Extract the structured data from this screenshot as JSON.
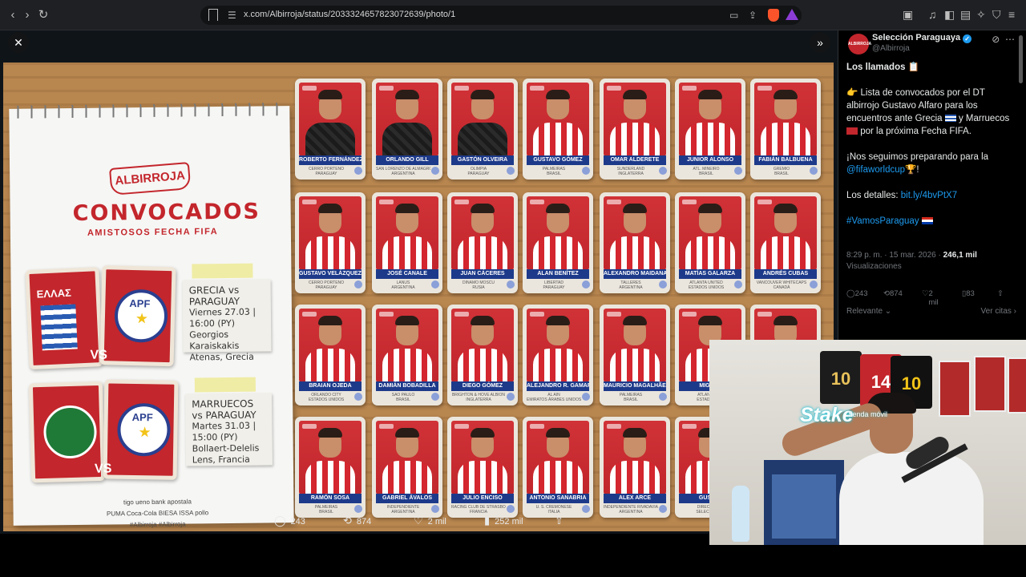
{
  "browser": {
    "url": "x.com/Albirroja/status/2033324657823072639/photo/1",
    "back_glyph": "‹",
    "forward_glyph": "›",
    "reload_glyph": "↻"
  },
  "viewer": {
    "close_glyph": "✕",
    "expand_glyph": "»",
    "stats": {
      "replies": "243",
      "reposts": "874",
      "likes": "2 mil",
      "views": "252 mil"
    }
  },
  "graphic": {
    "brand": "ALBIRROJA",
    "title": "CONVOCADOS",
    "subtitle": "AMISTOSOS FECHA FIFA",
    "greece_label": "ΕΛΛΑΣ",
    "apf_label": "APF",
    "vs": "VS",
    "match1": {
      "line1": "GRECIA vs",
      "line2": "PARAGUAY",
      "line3": "Viernes 27.03 | 16:00 (PY)",
      "line4": "Georgios Karaiskakis",
      "line5": "Atenas, Grecia"
    },
    "match2": {
      "line1": "MARRUECOS",
      "line2": "vs PARAGUAY",
      "line3": "Martes 31.03 | 15:00 (PY)",
      "line4": "Bollaert-Delelis",
      "line5": "Lens, Francia"
    },
    "sponsors_line1": "tigo   ueno bank   apostala",
    "sponsors_line2": "PUMA   Coca-Cola   BIESA   ISSA   pollo",
    "sponsors_line3": "#Albirroja   #Albirroja"
  },
  "players": [
    {
      "name": "ROBERTO FERNÁNDEZ",
      "club": "CERRO PORTEÑO",
      "country": "PARAGUAY",
      "gk": true
    },
    {
      "name": "ORLANDO GILL",
      "club": "SAN LORENZO DE ALMAGRO",
      "country": "ARGENTINA",
      "gk": true
    },
    {
      "name": "GASTÓN OLVEIRA",
      "club": "OLIMPIA",
      "country": "PARAGUAY",
      "gk": true
    },
    {
      "name": "GUSTAVO GÓMEZ",
      "club": "PALMEIRAS",
      "country": "BRASIL",
      "gk": false
    },
    {
      "name": "OMAR ALDERETE",
      "club": "SUNDERLAND",
      "country": "INGLATERRA",
      "gk": false
    },
    {
      "name": "JUNIOR ALONSO",
      "club": "ATL. MINEIRO",
      "country": "BRASIL",
      "gk": false
    },
    {
      "name": "FABIÁN BALBUENA",
      "club": "GRÊMIO",
      "country": "BRASIL",
      "gk": false
    },
    {
      "name": "GUSTAVO VELÁZQUEZ",
      "club": "CERRO PORTEÑO",
      "country": "PARAGUAY",
      "gk": false
    },
    {
      "name": "JOSÉ CANALE",
      "club": "LANÚS",
      "country": "ARGENTINA",
      "gk": false
    },
    {
      "name": "JUAN CÁCERES",
      "club": "DINAMO MOSCÚ",
      "country": "RUSIA",
      "gk": false
    },
    {
      "name": "ALAN BENÍTEZ",
      "club": "LIBERTAD",
      "country": "PARAGUAY",
      "gk": false
    },
    {
      "name": "ALEXANDRO MAIDANA",
      "club": "TALLERES",
      "country": "ARGENTINA",
      "gk": false
    },
    {
      "name": "MATÍAS GALARZA",
      "club": "ATLANTA UNITED",
      "country": "ESTADOS UNIDOS",
      "gk": false
    },
    {
      "name": "ANDRÉS CUBAS",
      "club": "VANCOUVER WHITECAPS",
      "country": "CANADÁ",
      "gk": false
    },
    {
      "name": "BRAIAN OJEDA",
      "club": "ORLANDO CITY",
      "country": "ESTADOS UNIDOS",
      "gk": false
    },
    {
      "name": "DAMIÁN BOBADILLA",
      "club": "SÃO PAULO",
      "country": "BRASIL",
      "gk": false
    },
    {
      "name": "DIEGO GÓMEZ",
      "club": "BRIGHTON & HOVE ALBION",
      "country": "INGLATERRA",
      "gk": false
    },
    {
      "name": "ALEJANDRO R. GAMARRA",
      "club": "AL AIN",
      "country": "EMIRATOS ÁRABES UNIDOS",
      "gk": false
    },
    {
      "name": "MAURICIO MAGALHÃES",
      "club": "PALMEIRAS",
      "country": "BRASIL",
      "gk": false
    },
    {
      "name": "MIGUEL",
      "club": "ATLANTA",
      "country": "ESTADOS",
      "gk": false
    },
    {
      "name": "",
      "club": "",
      "country": "",
      "gk": false
    },
    {
      "name": "RAMÓN SOSA",
      "club": "PALMEIRAS",
      "country": "BRASIL",
      "gk": false
    },
    {
      "name": "GABRIEL ÁVALOS",
      "club": "INDEPENDIENTE",
      "country": "ARGENTINA",
      "gk": false
    },
    {
      "name": "JULIO ENCISO",
      "club": "RACING CLUB DE STRASBOURG",
      "country": "FRANCIA",
      "gk": false
    },
    {
      "name": "ANTONIO SANABRIA",
      "club": "U. S. CREMONESE",
      "country": "ITALIA",
      "gk": false
    },
    {
      "name": "ALEX ARCE",
      "club": "INDEPENDIENTE RIVADAVIA",
      "country": "ARGENTINA",
      "gk": false
    },
    {
      "name": "GUSTAV",
      "club": "DIRECTO",
      "country": "SELECCIÓ",
      "gk": false
    }
  ],
  "tweet": {
    "display_name": "Selección Paraguaya",
    "handle": "@Albirroja",
    "avatar_text": "ALBIRROJA",
    "p1": "Los llamados 📋",
    "p2a": "👉 Lista de convocados por el DT albirrojo Gustavo Alfaro para los encuentros ante Grecia",
    "p2b": "y Marruecos",
    "p2c": "por la próxima Fecha FIFA.",
    "p3a": "¡Nos seguimos preparando para la",
    "p3_link": "@fifaworldcup",
    "p3b": "🏆!",
    "p4a": "Los detalles:",
    "p4_link": "bit.ly/4bvPtX7",
    "p5_link": "#VamosParaguay",
    "time": "8:29 p. m. · 15 mar. 2026 ·",
    "views_count": "246,1 mil",
    "views_label": "Visualizaciones",
    "replies": "243",
    "reposts": "874",
    "likes": "2 mil",
    "bookmarks": "83",
    "sort_label": "Relevante",
    "quotes_label": "Ver citas"
  },
  "webcam": {
    "stake_label": "Stake",
    "stake_sub": "tienda móvil",
    "jersey1": "10",
    "jersey2": "14",
    "jersey3": "10"
  },
  "colors": {
    "albirroja_red": "#c3262c",
    "sticker_blue": "#1d3a8a",
    "x_blue": "#1d9bf0"
  }
}
